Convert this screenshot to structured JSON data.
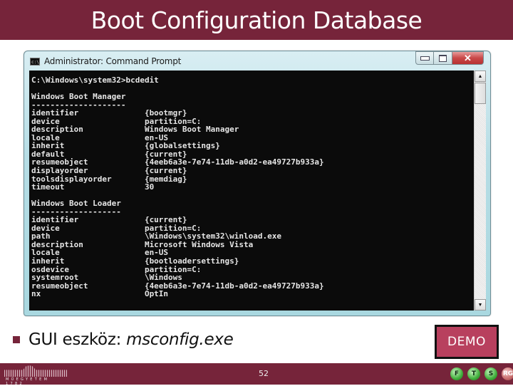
{
  "slide": {
    "title": "Boot Configuration Database",
    "page_number": "52"
  },
  "window": {
    "title": "Administrator: Command Prompt",
    "icon": "command-prompt-icon",
    "controls": {
      "minimize": "minimize-icon",
      "maximize": "maximize-icon",
      "close": "✕"
    }
  },
  "console": {
    "text": "C:\\Windows\\system32>bcdedit\n\nWindows Boot Manager\n--------------------\nidentifier              {bootmgr}\ndevice                  partition=C:\ndescription             Windows Boot Manager\nlocale                  en-US\ninherit                 {globalsettings}\ndefault                 {current}\nresumeobject            {4eeb6a3e-7e74-11db-a0d2-ea49727b933a}\ndisplayorder            {current}\ntoolsdisplayorder       {memdiag}\ntimeout                 30\n\nWindows Boot Loader\n-------------------\nidentifier              {current}\ndevice                  partition=C:\npath                    \\Windows\\system32\\winload.exe\ndescription             Microsoft Windows Vista\nlocale                  en-US\ninherit                 {bootloadersettings}\nosdevice                partition=C:\nsystemroot              \\Windows\nresumeobject            {4eeb6a3e-7e74-11db-a0d2-ea49727b933a}\nnx                      OptIn",
    "scrollbar": {
      "up": "▲",
      "down": "▼"
    }
  },
  "bullet": {
    "prefix": "GUI eszköz: ",
    "emphasis": "msconfig.exe"
  },
  "demo_button": {
    "label": "DEMO"
  },
  "footer": {
    "logo_text": "MŰEGYETEM 1782",
    "badges": [
      "F",
      "T",
      "S",
      "RG"
    ]
  },
  "colors": {
    "brand": "#76243a",
    "demo": "#b8405e",
    "console_bg": "#0b0b0b"
  }
}
